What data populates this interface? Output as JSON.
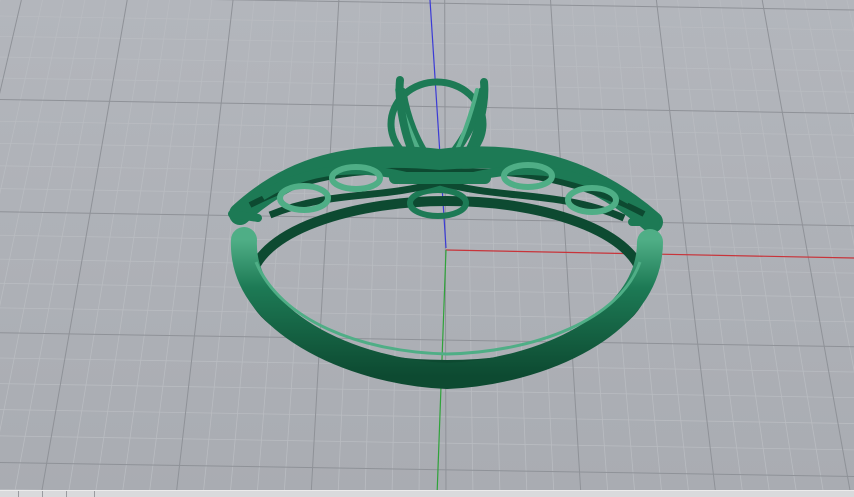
{
  "app": {
    "view": "perspective-viewport"
  },
  "viewport": {
    "background_color": "#a9acb2",
    "background_top_color": "#b3b6bc",
    "grid_minor_color": "#b9bcc1",
    "grid_major_color": "#8f9298",
    "axis_x_color": "#c8343a",
    "axis_y_color": "#2fa33a",
    "axis_z_color": "#3b3bd6",
    "grid_visible": true,
    "axes_visible": true
  },
  "model": {
    "name": "ring",
    "material_color": "#1d7a55",
    "material_shadow": "#0d4a31",
    "material_highlight": "#4fae86",
    "parts": [
      "shank",
      "twisted-band",
      "prong-head"
    ]
  },
  "statusbar": {
    "visible": true
  }
}
